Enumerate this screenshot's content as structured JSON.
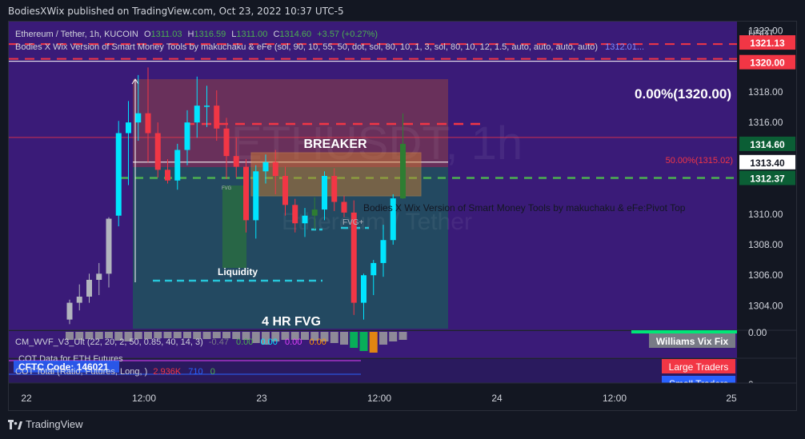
{
  "header": {
    "published": "BodiesXWix published on TradingView.com, Oct 23, 2022 10:37 UTC-5"
  },
  "legend": {
    "symbol": "Ethereum / Tether, 1h, KUCOIN",
    "ohlc": [
      {
        "k": "O",
        "v": "1311.03"
      },
      {
        "k": "H",
        "v": "1316.59"
      },
      {
        "k": "L",
        "v": "1311.00"
      },
      {
        "k": "C",
        "v": "1314.60"
      }
    ],
    "change": "+3.57 (+0.27%)",
    "indicator": "Bodies X Wix Version of Smart Money Tools by makuchaku & eFe (sol, 90, 10, 55, 50, dot, sol, 80, 10, 1, 3, sol, 80, 10, 12, 1.5, auto, auto, auto, auto)",
    "indicator_value": "1312.01..."
  },
  "watermark": {
    "line1": "ETHUSDT, 1h",
    "line2": "Ethereum / Tether"
  },
  "price_axis": {
    "currency": "USDT",
    "ticks": [
      "1322.00",
      "1318.00",
      "1316.00",
      "1310.00",
      "1308.00",
      "1306.00",
      "1304.00"
    ],
    "badges": [
      {
        "label": "1321.13",
        "price": 1321.13,
        "bg": "#f23645",
        "fg": "#ffffff"
      },
      {
        "label": "1320.00",
        "price": 1320.0,
        "bg": "#f23645",
        "fg": "#ffffff"
      },
      {
        "label": "1314.60",
        "price": 1314.6,
        "bg": "#0b5e35",
        "fg": "#ffffff"
      },
      {
        "label": "1313.40",
        "price": 1313.4,
        "bg": "#ffffff",
        "fg": "#131722"
      },
      {
        "label": "1312.37",
        "price": 1312.37,
        "bg": "#0b5e35",
        "fg": "#ffffff"
      }
    ]
  },
  "annotations": {
    "pct_label": "0.00%(1320.00)",
    "fib50": "50.00%(1315.02)",
    "breaker": "BREAKER",
    "pivot": "Bodies X Wix Version of Smart Money Tools by makuchaku & eFe:Pivot Top",
    "fvg_plus": "FVG+",
    "fvg_small": "FVG",
    "liquidity": "Liquidity",
    "four_hr_fvg": "4 HR FVG"
  },
  "wvf": {
    "label": "CM_WVF_V3_Ult (22, 20, 2, 50, 0.85, 40, 14, 3)",
    "values": [
      {
        "v": "-0.47",
        "color": "#787b86"
      },
      {
        "v": "0.00",
        "color": "#4caf50"
      },
      {
        "v": "0.00",
        "color": "#00e5ff"
      },
      {
        "v": "0.00",
        "color": "#e040fb"
      },
      {
        "v": "0.00",
        "color": "#ff9800"
      }
    ],
    "axis_zero": "0.00",
    "badge": "Williams Vix Fix"
  },
  "cot": {
    "futures_label": "COT Data for ETH Futures",
    "cftc": "CFTC Code: 146021",
    "total": "COT Total (Ratio, Futures, Long, )",
    "v1": "2.936K",
    "v2": "710",
    "v3": "0",
    "axis_zero": "0",
    "large": "Large Traders",
    "small": "Small Traders"
  },
  "time_axis": {
    "ticks": [
      "22",
      "12:00",
      "23",
      "12:00",
      "24",
      "12:00",
      "25"
    ]
  },
  "footer": {
    "brand": "TradingView"
  },
  "colors": {
    "bg": "#131722",
    "pane_purple": "#3a1b78",
    "up": "#00e5ff",
    "down": "#f23645",
    "neutral": "#b2b5be",
    "green_dash": "#4caf50",
    "red_dash": "#f23645"
  },
  "chart_data": {
    "type": "candlestick",
    "symbol": "ETHUSDT",
    "timeframe": "1h",
    "ylim": [
      1302.4,
      1322.6
    ],
    "x_ticks": [
      "22",
      "12:00",
      "23",
      "12:00",
      "24",
      "12:00",
      "25"
    ],
    "levels": {
      "dashed_red": [
        1321.13,
        1320.0,
        1315.9
      ],
      "dashed_green": 1312.37,
      "last_price": 1314.6,
      "white_line": 1313.4,
      "fib_0": 1320.0,
      "fib_50": 1315.02
    },
    "candles": [
      {
        "o": 1303.1,
        "h": 1304.4,
        "l": 1302.8,
        "c": 1304.2
      },
      {
        "o": 1304.2,
        "h": 1305.4,
        "l": 1303.7,
        "c": 1304.6
      },
      {
        "o": 1304.6,
        "h": 1306.1,
        "l": 1304.2,
        "c": 1305.7
      },
      {
        "o": 1305.7,
        "h": 1306.8,
        "l": 1304.7,
        "c": 1306.1
      },
      {
        "o": 1306.1,
        "h": 1309.8,
        "l": 1305.2,
        "c": 1309.7
      },
      {
        "o": 1309.9,
        "h": 1316.1,
        "l": 1309.2,
        "c": 1315.3
      },
      {
        "o": 1315.3,
        "h": 1317.4,
        "l": 1311.9,
        "c": 1316.0
      },
      {
        "o": 1316.0,
        "h": 1319.1,
        "l": 1314.8,
        "c": 1316.6
      },
      {
        "o": 1316.6,
        "h": 1319.6,
        "l": 1313.4,
        "c": 1315.3
      },
      {
        "o": 1315.3,
        "h": 1316.0,
        "l": 1312.4,
        "c": 1312.9
      },
      {
        "o": 1312.9,
        "h": 1313.6,
        "l": 1312.0,
        "c": 1312.2
      },
      {
        "o": 1312.2,
        "h": 1314.6,
        "l": 1311.6,
        "c": 1314.2
      },
      {
        "o": 1314.2,
        "h": 1316.8,
        "l": 1313.2,
        "c": 1316.0
      },
      {
        "o": 1316.0,
        "h": 1319.0,
        "l": 1315.0,
        "c": 1317.1
      },
      {
        "o": 1317.1,
        "h": 1318.4,
        "l": 1315.7,
        "c": 1317.1
      },
      {
        "o": 1317.1,
        "h": 1318.1,
        "l": 1314.8,
        "c": 1315.6
      },
      {
        "o": 1315.6,
        "h": 1316.3,
        "l": 1312.3,
        "c": 1313.8
      },
      {
        "o": 1313.8,
        "h": 1315.0,
        "l": 1312.4,
        "c": 1313.1
      },
      {
        "o": 1313.1,
        "h": 1313.6,
        "l": 1308.8,
        "c": 1309.6
      },
      {
        "o": 1309.6,
        "h": 1313.2,
        "l": 1308.4,
        "c": 1312.8
      },
      {
        "o": 1312.8,
        "h": 1313.9,
        "l": 1312.0,
        "c": 1313.4
      },
      {
        "o": 1313.4,
        "h": 1314.2,
        "l": 1311.3,
        "c": 1312.5
      },
      {
        "o": 1312.5,
        "h": 1313.1,
        "l": 1309.9,
        "c": 1310.6
      },
      {
        "o": 1310.6,
        "h": 1311.0,
        "l": 1308.8,
        "c": 1309.4
      },
      {
        "o": 1309.4,
        "h": 1310.4,
        "l": 1308.5,
        "c": 1309.9
      },
      {
        "o": 1309.9,
        "h": 1311.1,
        "l": 1309.0,
        "c": 1310.3
      },
      {
        "o": 1310.3,
        "h": 1312.8,
        "l": 1309.6,
        "c": 1312.5
      },
      {
        "o": 1312.5,
        "h": 1313.0,
        "l": 1310.2,
        "c": 1310.8
      },
      {
        "o": 1310.8,
        "h": 1311.2,
        "l": 1309.8,
        "c": 1310.1
      },
      {
        "o": 1310.1,
        "h": 1310.9,
        "l": 1303.4,
        "c": 1304.2
      },
      {
        "o": 1304.2,
        "h": 1306.1,
        "l": 1303.1,
        "c": 1306.0
      },
      {
        "o": 1306.0,
        "h": 1307.0,
        "l": 1304.7,
        "c": 1306.8
      },
      {
        "o": 1306.8,
        "h": 1309.3,
        "l": 1305.9,
        "c": 1308.3
      },
      {
        "o": 1308.3,
        "h": 1311.3,
        "l": 1308.0,
        "c": 1311.03
      },
      {
        "o": 1311.03,
        "h": 1316.59,
        "l": 1311.0,
        "c": 1314.6
      }
    ]
  }
}
